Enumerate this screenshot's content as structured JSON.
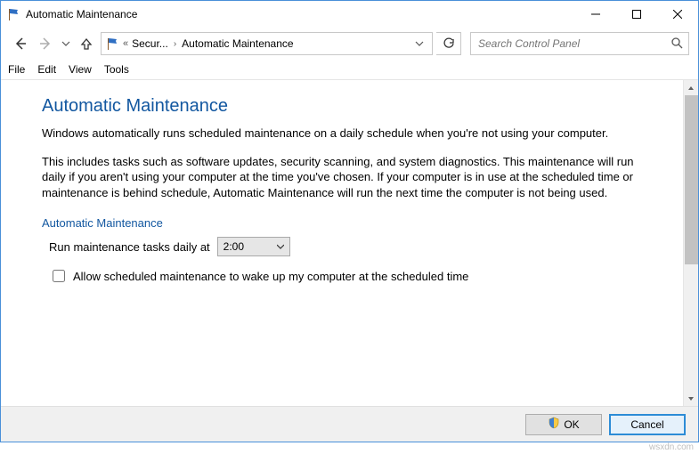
{
  "window": {
    "title": "Automatic Maintenance"
  },
  "breadcrumb": {
    "seg1": "Secur...",
    "seg2": "Automatic Maintenance"
  },
  "search": {
    "placeholder": "Search Control Panel"
  },
  "menu": {
    "file": "File",
    "edit": "Edit",
    "view": "View",
    "tools": "Tools"
  },
  "page": {
    "heading": "Automatic Maintenance",
    "para1": "Windows automatically runs scheduled maintenance on a daily schedule when you're not using your computer.",
    "para2": "This includes tasks such as software updates, security scanning, and system diagnostics. This maintenance will run daily if you aren't using your computer at the time you've chosen. If your computer is in use at the scheduled time or maintenance is behind schedule, Automatic Maintenance will run the next time the computer is not being used.",
    "section": "Automatic Maintenance",
    "schedule_label": "Run maintenance tasks daily at",
    "schedule_value": "2:00",
    "checkbox_label": "Allow scheduled maintenance to wake up my computer at the scheduled time"
  },
  "footer": {
    "ok": "OK",
    "cancel": "Cancel"
  },
  "watermark": "wsxdn.com"
}
